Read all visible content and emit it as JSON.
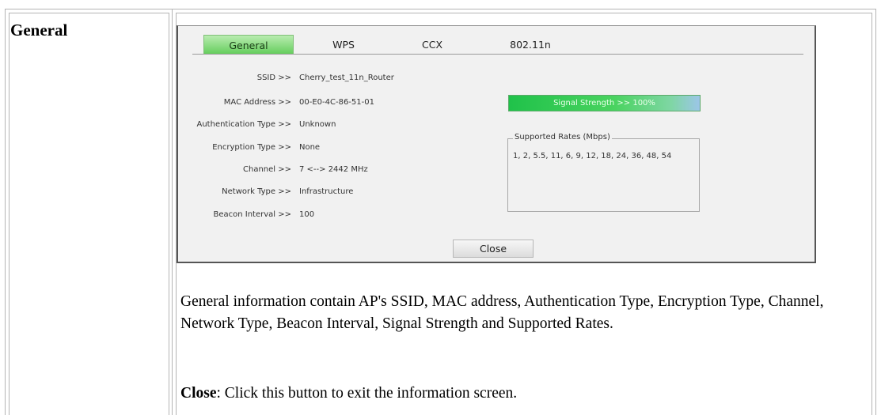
{
  "section": {
    "title": "General"
  },
  "dialog": {
    "tabs": [
      {
        "label": "General",
        "active": true
      },
      {
        "label": "WPS",
        "active": false
      },
      {
        "label": "CCX",
        "active": false
      },
      {
        "label": "802.11n",
        "active": false
      }
    ],
    "fields": [
      {
        "label": "SSID >>",
        "value": "Cherry_test_11n_Router"
      },
      {
        "label": "MAC Address >>",
        "value": "00-E0-4C-86-51-01"
      },
      {
        "label": "Authentication Type >>",
        "value": "Unknown"
      },
      {
        "label": "Encryption Type >>",
        "value": "None"
      },
      {
        "label": "Channel >>",
        "value": "7 <--> 2442 MHz"
      },
      {
        "label": "Network Type >>",
        "value": "Infrastructure"
      },
      {
        "label": "Beacon Interval >>",
        "value": "100"
      }
    ],
    "signal": {
      "text": "Signal Strength >> 100%",
      "percent": 100
    },
    "rates": {
      "legend": "Supported Rates (Mbps)",
      "values": "1, 2, 5.5, 11, 6, 9, 12, 18, 24, 36, 48, 54"
    },
    "close_label": "Close",
    "colors": {
      "active_tab": "#62cd5a",
      "signal": "#20c24a"
    }
  },
  "description": {
    "text": "General information contain AP's SSID, MAC address, Authentication Type, Encryption Type, Channel, Network Type, Beacon Interval, Signal Strength and Supported Rates.",
    "close_term": "Close",
    "close_text": ": Click this button to exit the information screen."
  }
}
